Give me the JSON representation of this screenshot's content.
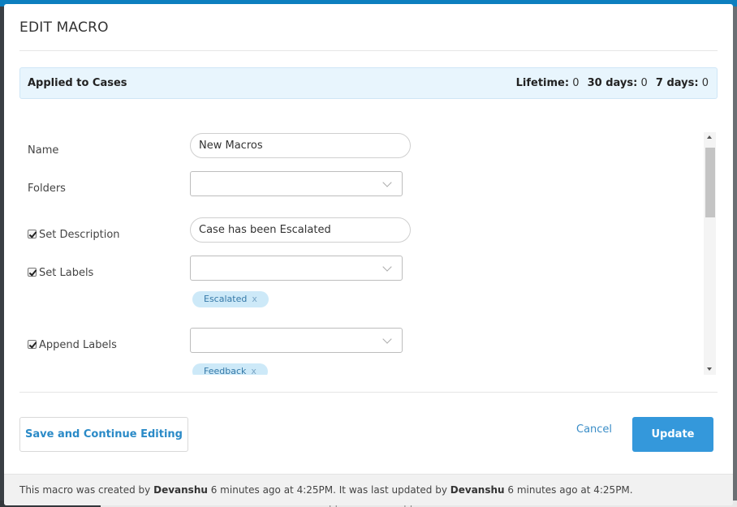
{
  "modal": {
    "title": "EDIT MACRO"
  },
  "applied": {
    "title": "Applied to Cases",
    "lifetime_label": "Lifetime:",
    "lifetime_value": "0",
    "days30_label": "30 days:",
    "days30_value": "0",
    "days7_label": "7 days:",
    "days7_value": "0"
  },
  "form": {
    "name_label": "Name",
    "name_value": "New Macros",
    "folders_label": "Folders",
    "set_description_label": "Set Description",
    "set_description_value": "Case has been Escalated",
    "set_labels_label": "Set Labels",
    "set_labels_tags": [
      "Escalated"
    ],
    "append_labels_label": "Append Labels",
    "append_labels_tags": [
      "Feedback"
    ],
    "tag_remove_glyph": "x"
  },
  "buttons": {
    "save_continue": "Save and Continue Editing",
    "cancel": "Cancel",
    "update": "Update"
  },
  "status": {
    "prefix": "This macro was created by",
    "creator": "Devanshu",
    "created_time": "6 minutes ago at 4:25PM.",
    "middle": "It was last updated by",
    "updater": "Devanshu",
    "updated_time": "6 minutes ago at 4:25PM."
  },
  "background": {
    "partial_text": "See case status tracked · Append Article Application"
  },
  "colors": {
    "accent": "#3498db",
    "link": "#3a8dc7",
    "info_bg": "#e8f5fd",
    "tag_bg": "#cde9f8"
  }
}
